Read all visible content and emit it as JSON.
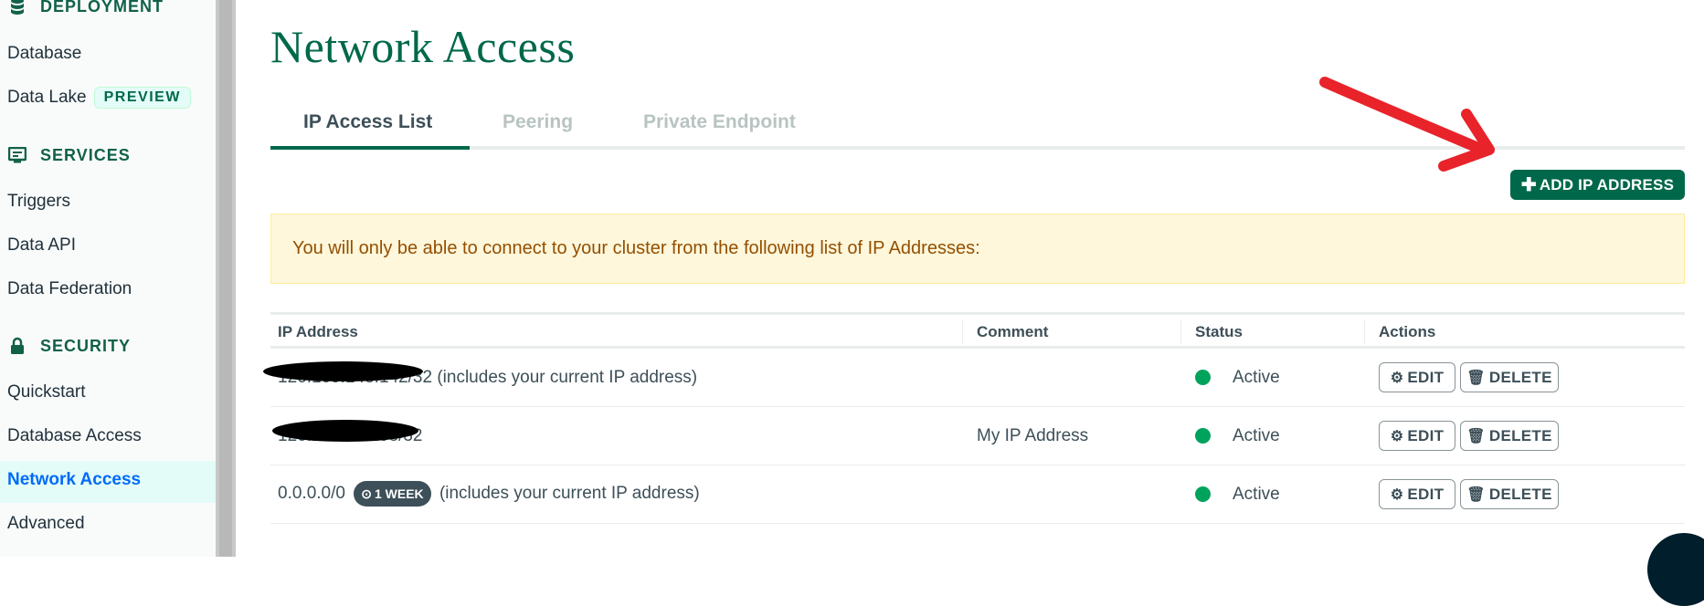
{
  "sidebar": {
    "sections": [
      {
        "title": "DEPLOYMENT",
        "icon": "database-icon",
        "items": [
          {
            "label": "Database"
          },
          {
            "label": "Data Lake",
            "badge": "PREVIEW"
          }
        ]
      },
      {
        "title": "SERVICES",
        "icon": "services-icon",
        "items": [
          {
            "label": "Triggers"
          },
          {
            "label": "Data API"
          },
          {
            "label": "Data Federation"
          }
        ]
      },
      {
        "title": "SECURITY",
        "icon": "lock-icon",
        "items": [
          {
            "label": "Quickstart"
          },
          {
            "label": "Database Access"
          },
          {
            "label": "Network Access",
            "active": true
          },
          {
            "label": "Advanced"
          }
        ]
      }
    ]
  },
  "page": {
    "title": "Network Access"
  },
  "tabs": [
    {
      "label": "IP Access List",
      "active": true
    },
    {
      "label": "Peering"
    },
    {
      "label": "Private Endpoint"
    }
  ],
  "add_button": {
    "label": "ADD IP ADDRESS"
  },
  "banner": {
    "text": "You will only be able to connect to your cluster from the following list of IP Addresses:"
  },
  "table": {
    "headers": [
      "IP Address",
      "Comment",
      "Status",
      "Actions"
    ],
    "rows": [
      {
        "ip": "126.169.148.142/32",
        "note": "(includes your current IP address)",
        "comment": "",
        "status": "Active",
        "redacted": true
      },
      {
        "ip": "126.169.140.93/32",
        "note": "",
        "comment": "My IP Address",
        "status": "Active",
        "redacted": true
      },
      {
        "ip": "0.0.0.0/0",
        "badge": "1 WEEK",
        "note": "(includes your current IP address)",
        "comment": "",
        "status": "Active"
      }
    ],
    "edit_label": "EDIT",
    "delete_label": "DELETE"
  },
  "colors": {
    "brand": "#00684a",
    "active_link": "#016bf8",
    "status_active": "#00a35c",
    "banner_bg": "#fef7db",
    "annotation_arrow": "#e8232a"
  }
}
